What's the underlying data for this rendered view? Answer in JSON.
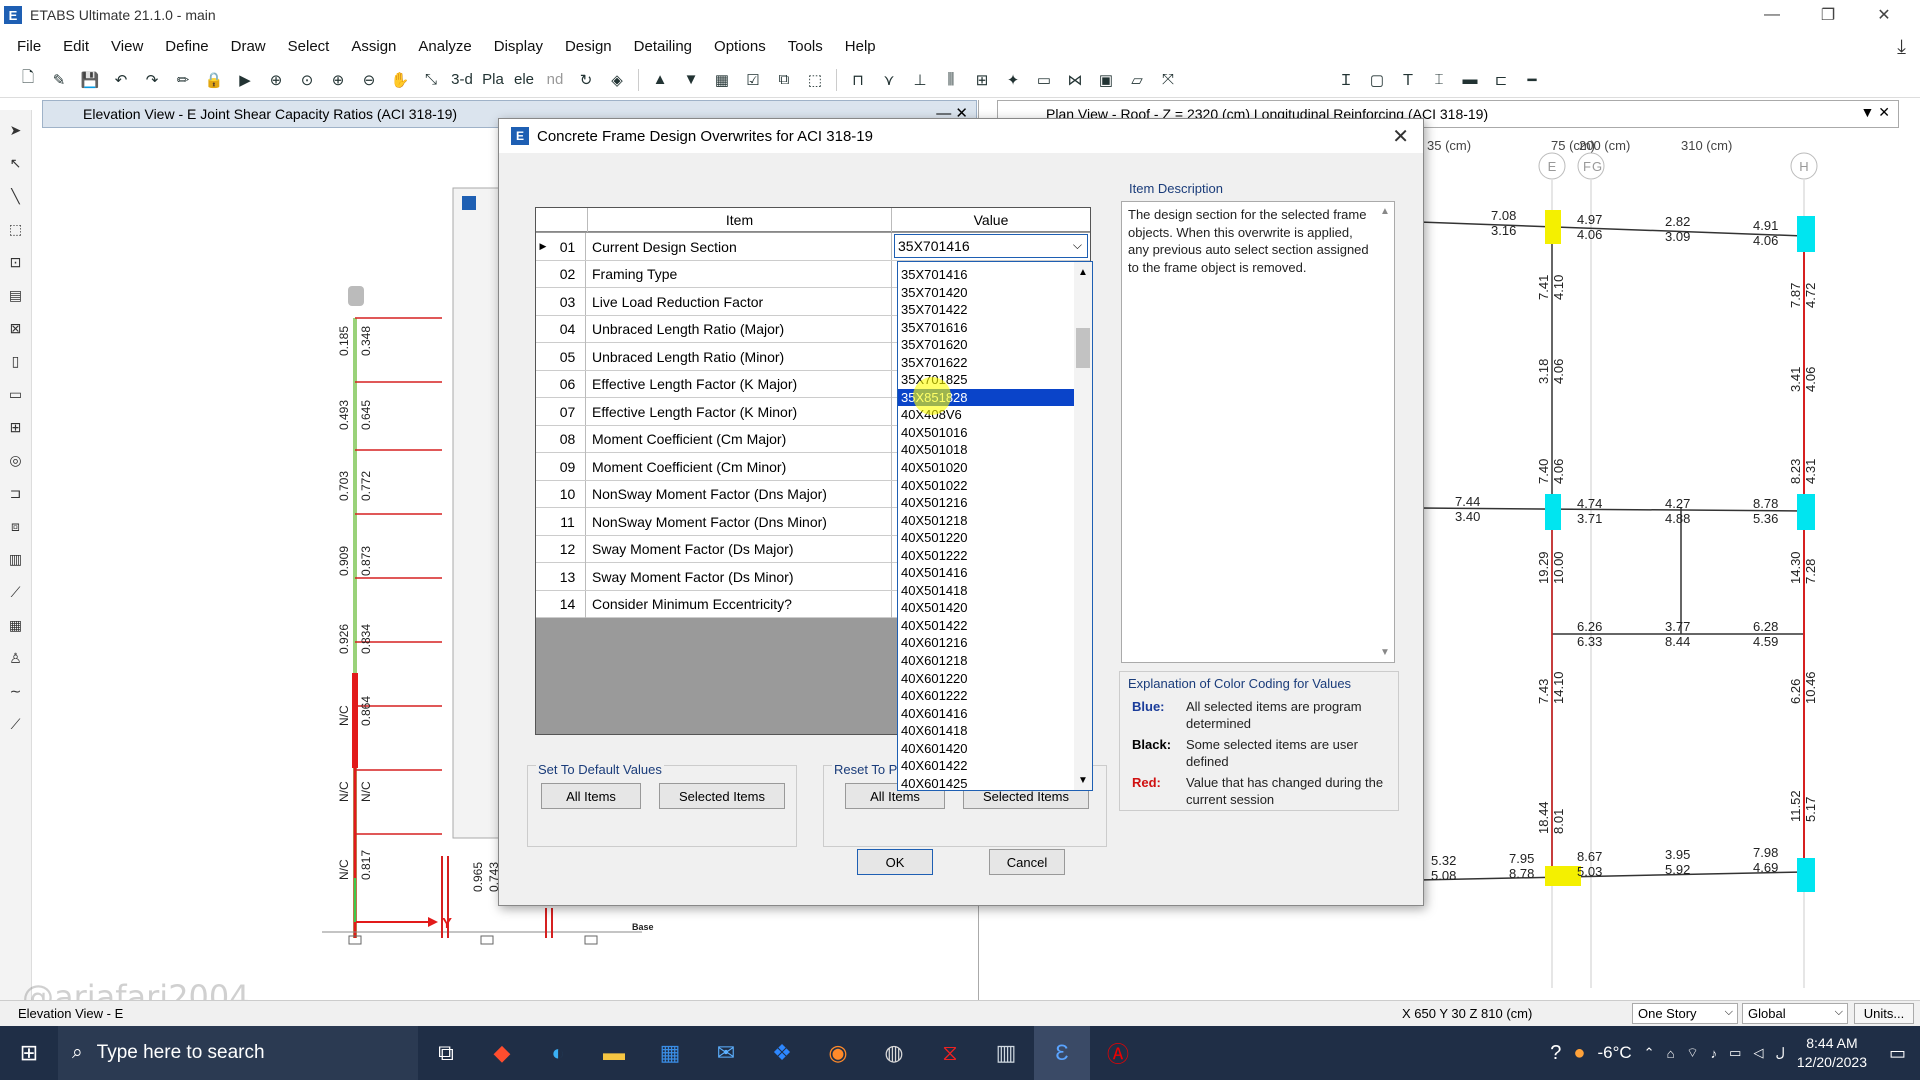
{
  "window": {
    "title": "ETABS Ultimate 21.1.0 - main",
    "icon_letter": "E",
    "controls": [
      "—",
      "❐",
      "✕"
    ]
  },
  "menu": [
    "File",
    "Edit",
    "View",
    "Define",
    "Draw",
    "Select",
    "Assign",
    "Analyze",
    "Display",
    "Design",
    "Detailing",
    "Options",
    "Tools",
    "Help"
  ],
  "toolbar_text": {
    "three_d": "3-d",
    "plan": "Pla",
    "elev": "ele",
    "nd": "nd"
  },
  "elevation_view": {
    "title": "Elevation View - E  Joint Shear Capacity Ratios  (ACI 318-19)",
    "col1_values": [
      "0.185",
      "0.493",
      "0.703",
      "0.909",
      "0.926",
      "N/C",
      "N/C",
      "N/C"
    ],
    "col2_values": [
      "0.348",
      "0.645",
      "0.772",
      "0.873",
      "0.834",
      "0.864",
      "N/C",
      "0.817"
    ],
    "col3_values": [
      "0.965",
      "0.743"
    ],
    "axis_label": "Y",
    "base_label": "Base"
  },
  "plan_view": {
    "title": "Plan View - Roof - Z = 2320 (cm)  Longitudinal Reinforcing  (ACI 318-19)",
    "dims": [
      "35 (cm)",
      "75 (cm)",
      "200 (cm)",
      "310 (cm)"
    ],
    "grid_labels": [
      "E",
      "F",
      "G",
      "H"
    ],
    "values": {
      "r1": [
        "7.08",
        "3.16",
        "4.97",
        "4.06",
        "2.82",
        "3.09",
        "4.91",
        "4.06"
      ],
      "c1": [
        "7.41",
        "4.10",
        "7.87",
        "4.72"
      ],
      "c2": [
        "3.18",
        "4.06",
        "3.41",
        "4.06"
      ],
      "c3": [
        "7.40",
        "4.06",
        "8.23",
        "4.31"
      ],
      "r2": [
        "7.44",
        "3.40",
        "4.74",
        "3.71",
        "4.27",
        "4.88",
        "8.78",
        "5.36"
      ],
      "c4": [
        "19.29",
        "10.00",
        "14.30",
        "7.28"
      ],
      "r3": [
        "6.26",
        "6.33",
        "3.77",
        "8.44",
        "6.28",
        "4.59"
      ],
      "c5": [
        "7.43",
        "14.10",
        "6.26",
        "10.46"
      ],
      "c6": [
        "18.44",
        "8.01",
        "11.52",
        "5.17"
      ],
      "r4": [
        "5.32",
        "5.08",
        "7.95",
        "8.78",
        "8.67",
        "5.03",
        "3.95",
        "5.92",
        "7.98",
        "4.69"
      ]
    },
    "colors": {
      "yellow": "#f4f000",
      "cyan": "#00e5f0",
      "line": "#333333",
      "red": "#d62020"
    }
  },
  "dialog": {
    "title": "Concrete Frame Design Overwrites for ACI 318-19",
    "icon_letter": "E",
    "close": "✕",
    "grid": {
      "headers": {
        "item": "Item",
        "value": "Value"
      },
      "rows": [
        {
          "num": "01",
          "item": "Current Design Section",
          "value": "35X701416"
        },
        {
          "num": "02",
          "item": "Framing Type",
          "value": ""
        },
        {
          "num": "03",
          "item": "Live Load Reduction Factor",
          "value": ""
        },
        {
          "num": "04",
          "item": "Unbraced Length Ratio (Major)",
          "value": ""
        },
        {
          "num": "05",
          "item": "Unbraced Length Ratio (Minor)",
          "value": ""
        },
        {
          "num": "06",
          "item": "Effective Length Factor (K Major)",
          "value": ""
        },
        {
          "num": "07",
          "item": "Effective Length Factor (K Minor)",
          "value": ""
        },
        {
          "num": "08",
          "item": "Moment Coefficient (Cm Major)",
          "value": ""
        },
        {
          "num": "09",
          "item": "Moment Coefficient (Cm Minor)",
          "value": ""
        },
        {
          "num": "10",
          "item": "NonSway Moment Factor (Dns Major)",
          "value": ""
        },
        {
          "num": "11",
          "item": "NonSway Moment Factor (Dns Minor)",
          "value": ""
        },
        {
          "num": "12",
          "item": "Sway Moment Factor (Ds Major)",
          "value": ""
        },
        {
          "num": "13",
          "item": "Sway Moment Factor (Ds Minor)",
          "value": ""
        },
        {
          "num": "14",
          "item": "Consider Minimum Eccentricity?",
          "value": ""
        }
      ]
    },
    "dropdown_options": [
      "35X701416",
      "35X701420",
      "35X701422",
      "35X701616",
      "35X701620",
      "35X701622",
      "35X701825",
      "35X851828",
      "40X408V6",
      "40X501016",
      "40X501018",
      "40X501020",
      "40X501022",
      "40X501216",
      "40X501218",
      "40X501220",
      "40X501222",
      "40X501416",
      "40X501418",
      "40X501420",
      "40X501422",
      "40X601216",
      "40X601218",
      "40X601220",
      "40X601222",
      "40X601416",
      "40X601418",
      "40X601420",
      "40X601422",
      "40X601425"
    ],
    "dropdown_selected": "35X851828",
    "item_description": {
      "label": "Item Description",
      "text": "The design section for the selected frame objects.  When this overwrite is applied, any previous auto select section assigned to the frame object is removed."
    },
    "color_coding": {
      "title": "Explanation of Color Coding for Values",
      "rows": [
        {
          "key": "Blue:",
          "text": "All selected items are program determined",
          "color": "#1a3c9a"
        },
        {
          "key": "Black:",
          "text": "Some selected items are user defined",
          "color": "#000000"
        },
        {
          "key": "Red:",
          "text": "Value that has changed during the current session",
          "color": "#d01010"
        }
      ]
    },
    "set_default": {
      "label": "Set To Default Values",
      "all": "All Items",
      "selected": "Selected Items"
    },
    "reset": {
      "label": "Reset To P",
      "all": "All Items",
      "selected": "Selected Items"
    },
    "ok": "OK",
    "cancel": "Cancel"
  },
  "statusbar": {
    "left": "Elevation View - E",
    "coords": "X 650  Y 30  Z 810 (cm)",
    "story": "One Story",
    "coord_sys": "Global",
    "units": "Units..."
  },
  "watermark": "@ariafari2004",
  "taskbar": {
    "search_placeholder": "Type here to search",
    "temperature": "-6°C",
    "time": "8:44 AM",
    "date": "12/20/2023"
  }
}
